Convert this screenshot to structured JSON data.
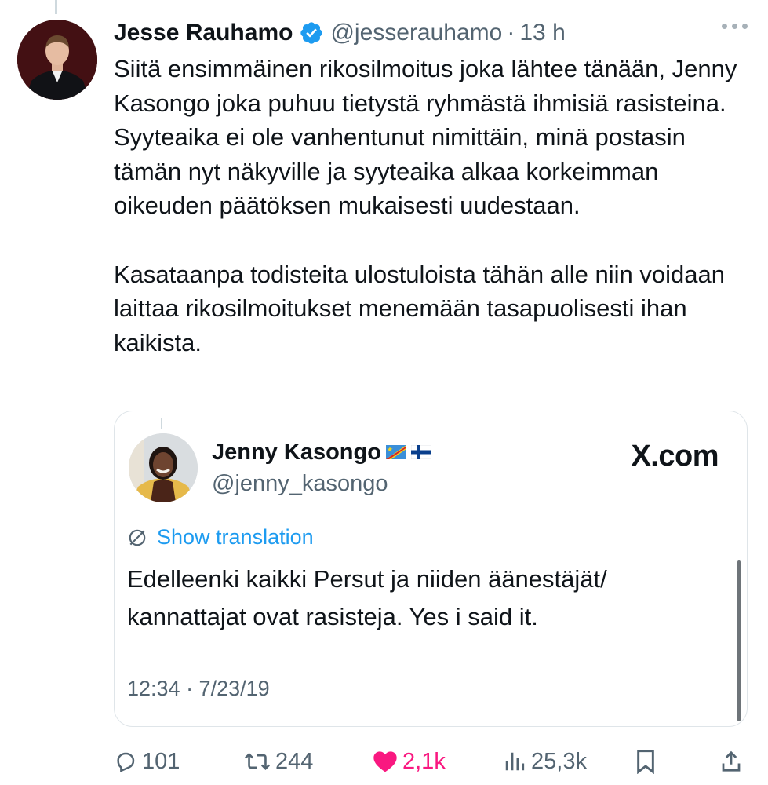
{
  "post": {
    "author_name": "Jesse Rauhamo",
    "handle": "@jesserauhamo",
    "separator": "·",
    "time": "13 h",
    "paragraph_1": "Siitä ensimmäinen rikosilmoitus joka lähtee tänään, Jenny Kasongo joka puhuu tietystä ryhmästä ihmisiä rasisteina. Syyteaika ei ole vanhentunut nimittäin, minä postasin tämän nyt näkyville ja syyteaika alkaa korkeimman oikeuden päätöksen mukaisesti uudestaan.",
    "paragraph_2": "Kasataanpa todisteita ulostuloista tähän alle niin voidaan laittaa rikosilmoitukset menemään tasapuolisesti ihan kaikista."
  },
  "quote": {
    "author_name": "Jenny Kasongo",
    "handle": "@jenny_kasongo",
    "site_label": "X.com",
    "translate_label": "Show translation",
    "text_line_1": "Edelleenki kaikki Persut ja niiden äänestäjät/",
    "text_line_2": "kannattajat ovat rasisteja. Yes i said it.",
    "timestamp": "12:34 · 7/23/19"
  },
  "actions": {
    "replies": "101",
    "reposts": "244",
    "likes": "2,1k",
    "views": "25,3k"
  },
  "colors": {
    "verified": "#1d9bf0",
    "like": "#f91880",
    "link": "#1d9bf0",
    "muted": "#536471"
  },
  "icons": [
    "verified-badge-icon",
    "more-icon",
    "translate-icon",
    "reply-icon",
    "repost-icon",
    "heart-icon",
    "views-icon",
    "bookmark-icon",
    "share-icon"
  ]
}
